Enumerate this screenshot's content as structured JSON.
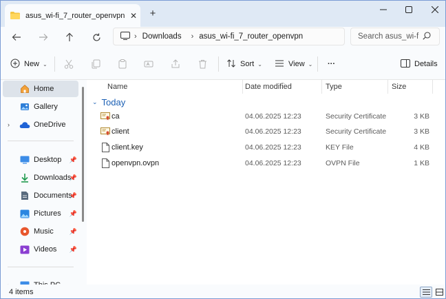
{
  "window": {
    "tab_title": "asus_wi-fi_7_router_openvpn",
    "new_tab": "+"
  },
  "address": {
    "crumbs": [
      "Downloads",
      "asus_wi-fi_7_router_openvpn"
    ],
    "search_placeholder": "Search asus_wi-f"
  },
  "toolbar": {
    "new_label": "New",
    "sort_label": "Sort",
    "view_label": "View",
    "more_label": "···",
    "details_label": "Details"
  },
  "sidebar": {
    "items": [
      {
        "label": "Home",
        "icon": "home-icon",
        "selected": true
      },
      {
        "label": "Gallery",
        "icon": "gallery-icon"
      },
      {
        "label": "OneDrive",
        "icon": "onedrive-icon",
        "expandable": true
      },
      {
        "label": "Desktop",
        "icon": "desktop-icon",
        "pinned": true
      },
      {
        "label": "Downloads",
        "icon": "downloads-icon",
        "pinned": true
      },
      {
        "label": "Documents",
        "icon": "documents-icon",
        "pinned": true
      },
      {
        "label": "Pictures",
        "icon": "pictures-icon",
        "pinned": true
      },
      {
        "label": "Music",
        "icon": "music-icon",
        "pinned": true
      },
      {
        "label": "Videos",
        "icon": "videos-icon",
        "pinned": true
      },
      {
        "label": "This PC",
        "icon": "this-pc-icon",
        "expandable": true
      }
    ]
  },
  "columns": {
    "name": "Name",
    "date": "Date modified",
    "type": "Type",
    "size": "Size"
  },
  "group": {
    "label": "Today"
  },
  "files": [
    {
      "name": "ca",
      "date": "04.06.2025 12:23",
      "type": "Security Certificate",
      "size": "3 KB",
      "icon": "certificate-icon"
    },
    {
      "name": "client",
      "date": "04.06.2025 12:23",
      "type": "Security Certificate",
      "size": "3 KB",
      "icon": "certificate-icon"
    },
    {
      "name": "client.key",
      "date": "04.06.2025 12:23",
      "type": "KEY File",
      "size": "4 KB",
      "icon": "file-icon"
    },
    {
      "name": "openvpn.ovpn",
      "date": "04.06.2025 12:23",
      "type": "OVPN File",
      "size": "1 KB",
      "icon": "file-icon"
    }
  ],
  "status": {
    "count": "4 items"
  },
  "colors": {
    "accent": "#1a5fb4",
    "titlebar": "#dfe9f5",
    "selected": "#dde3ea"
  }
}
